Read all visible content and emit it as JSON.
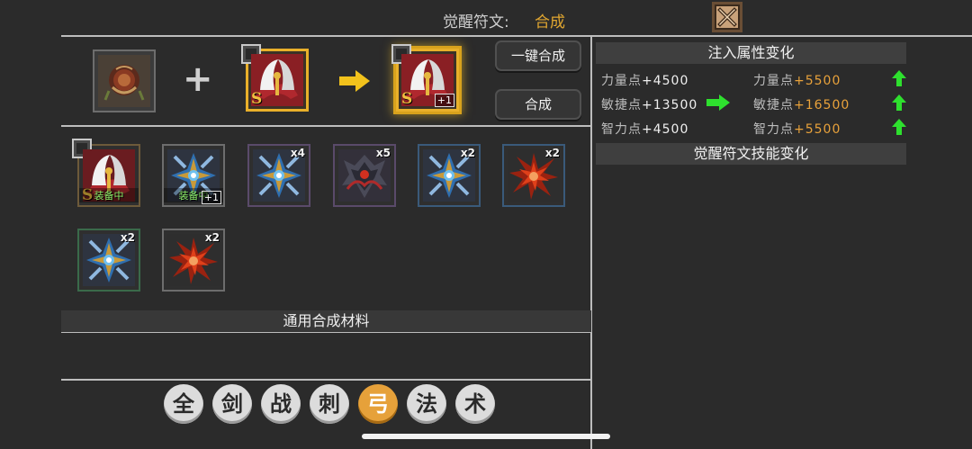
{
  "header": {
    "title": "觉醒符文:",
    "mode": "合成",
    "close_icon": "close-x-icon"
  },
  "synthesis": {
    "plus_symbol": "+",
    "arrow_icon": "yellow-arrow-right-icon",
    "material_rune": {
      "icon": "rose-rune-icon"
    },
    "base_rune": {
      "icon": "scythe-rune-icon",
      "grade": "S"
    },
    "result_rune": {
      "icon": "scythe-rune-icon",
      "grade": "S",
      "level_badge": "+1"
    },
    "one_click_button": "一键合成",
    "synth_button": "合成"
  },
  "inventory": {
    "items": [
      {
        "icon": "scythe-rune-icon",
        "grade": "S",
        "status": "装备中",
        "count": ""
      },
      {
        "icon": "blue-cross-rune-icon",
        "status": "装备中",
        "level_badge": "+1",
        "count": ""
      },
      {
        "icon": "blue-cross-rune-icon",
        "count": "x4"
      },
      {
        "icon": "dark-demon-rune-icon",
        "count": "x5"
      },
      {
        "icon": "blue-cross-rune-icon",
        "count": "x2"
      },
      {
        "icon": "red-star-rune-icon",
        "count": "x2"
      },
      {
        "icon": "blue-cross-rune-icon",
        "count": "x2"
      },
      {
        "icon": "red-star-rune-icon",
        "count": "x2"
      }
    ]
  },
  "materials": {
    "header": "通用合成材料"
  },
  "filter_tabs": [
    {
      "label": "全",
      "active": false
    },
    {
      "label": "剑",
      "active": false
    },
    {
      "label": "战",
      "active": false
    },
    {
      "label": "刺",
      "active": false
    },
    {
      "label": "弓",
      "active": true
    },
    {
      "label": "法",
      "active": false
    },
    {
      "label": "术",
      "active": false
    }
  ],
  "attributes": {
    "header": "注入属性变化",
    "rows": [
      {
        "before_label": "力量点",
        "before_value": "+4500",
        "after_label": "力量点",
        "after_value": "+5500",
        "indicator": "green-up-arrow-icon"
      },
      {
        "before_label": "敏捷点",
        "before_value": "+13500",
        "after_label": "敏捷点",
        "after_value": "+16500",
        "indicator": "green-up-arrow-icon"
      },
      {
        "before_label": "智力点",
        "before_value": "+4500",
        "after_label": "智力点",
        "after_value": "+5500",
        "indicator": "green-up-arrow-icon"
      }
    ],
    "row_arrow": "green-arrow-right-icon"
  },
  "skills": {
    "header": "觉醒符文技能变化"
  },
  "colors": {
    "background": "#2b2b2b",
    "accent_orange": "#e6a13a",
    "gold_border": "#e9b02a",
    "green": "#2ee02e",
    "equipped_green": "#8ef06a"
  }
}
